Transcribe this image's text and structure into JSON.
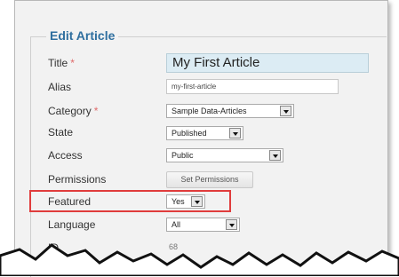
{
  "form": {
    "legend": "Edit Article",
    "title_label": "Title",
    "title_required": "*",
    "title_value": "My First Article",
    "alias_label": "Alias",
    "alias_value": "my-first-article",
    "category_label": "Category",
    "category_required": "*",
    "category_value": "Sample Data-Articles",
    "state_label": "State",
    "state_value": "Published",
    "access_label": "Access",
    "access_value": "Public",
    "permissions_label": "Permissions",
    "permissions_button": "Set Permissions",
    "featured_label": "Featured",
    "featured_value": "Yes",
    "language_label": "Language",
    "language_value": "All",
    "id_label": "ID",
    "id_value": "68"
  },
  "colors": {
    "legend": "#2f6f9f",
    "required": "#e06b6b",
    "highlight": "#e03c3c",
    "title_bg": "#dcecf4"
  }
}
